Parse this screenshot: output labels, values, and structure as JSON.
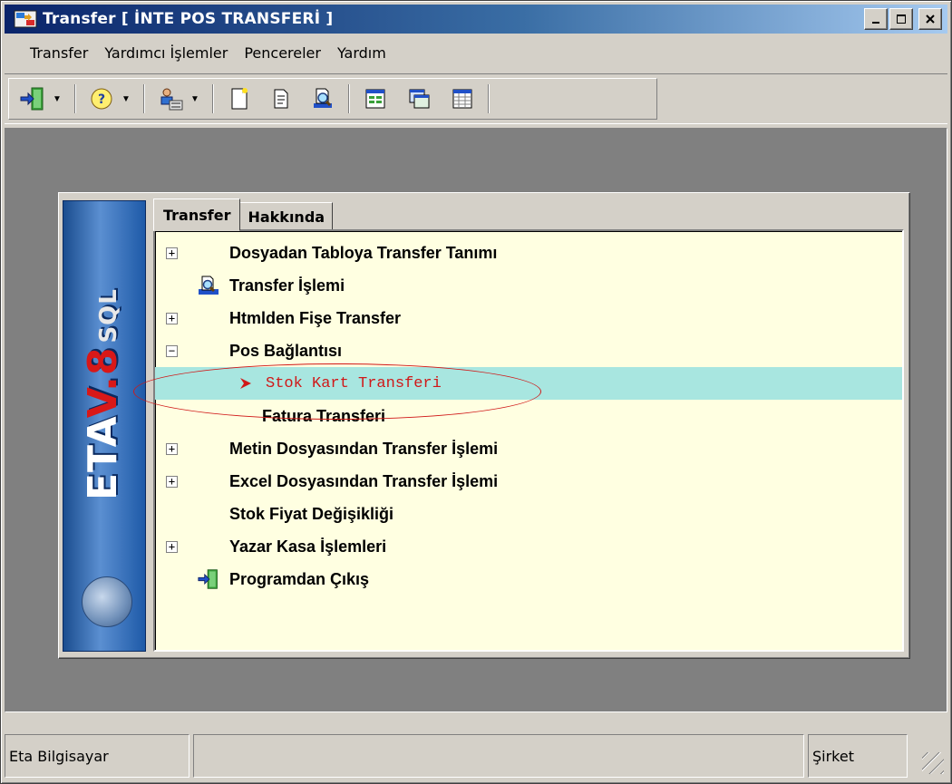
{
  "window": {
    "title": "Transfer [ İNTE POS TRANSFERİ ]",
    "icon": "transfer-app-icon"
  },
  "menu": [
    "Transfer",
    "Yardımcı İşlemler",
    "Pencereler",
    "Yardım"
  ],
  "toolbar": {
    "icons": [
      "exit-door-icon",
      "help-icon",
      "user-settings-icon",
      "new-document-icon",
      "document-icon",
      "preview-icon",
      "window-cascade-icon",
      "window-tile-icon",
      "window-grid-icon"
    ]
  },
  "logo": {
    "brand": "ETA",
    "version": "V.8",
    "suffix": "SQL"
  },
  "tabs": [
    {
      "label": "Transfer",
      "active": true
    },
    {
      "label": "Hakkında",
      "active": false
    }
  ],
  "tree": [
    {
      "label": "Dosyadan Tabloya Transfer Tanımı",
      "expander": "+"
    },
    {
      "label": "Transfer İşlemi",
      "icon": "search-document-icon"
    },
    {
      "label": "Htmlden Fişe Transfer",
      "expander": "+"
    },
    {
      "label": "Pos Bağlantısı",
      "expander": "−"
    },
    {
      "label": "Stok Kart Transferi",
      "selected": true
    },
    {
      "label": "Fatura Transferi"
    },
    {
      "label": "Metin Dosyasından Transfer İşlemi",
      "expander": "+"
    },
    {
      "label": "Excel Dosyasından Transfer İşlemi",
      "expander": "+"
    },
    {
      "label": "Stok Fiyat Değişikliği"
    },
    {
      "label": "Yazar Kasa İşlemleri",
      "expander": "+"
    },
    {
      "label": "Programdan Çıkış",
      "icon": "exit-door-icon"
    }
  ],
  "status": {
    "company": "Eta Bilgisayar",
    "middle": "",
    "right": "Şirket"
  },
  "colors": {
    "tree_bg": "#ffffe1",
    "selected_bg": "#a8e6e0",
    "selected_text": "#d01818",
    "title_gradient_start": "#0a246a"
  }
}
